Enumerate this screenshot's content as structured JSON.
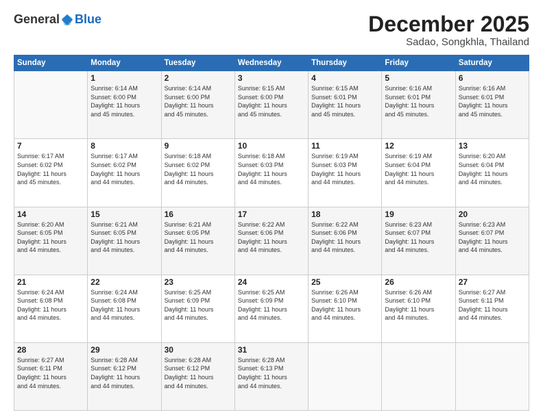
{
  "header": {
    "logo_general": "General",
    "logo_blue": "Blue",
    "title": "December 2025",
    "location": "Sadao, Songkhla, Thailand"
  },
  "days_of_week": [
    "Sunday",
    "Monday",
    "Tuesday",
    "Wednesday",
    "Thursday",
    "Friday",
    "Saturday"
  ],
  "weeks": [
    [
      {
        "day": "",
        "info": ""
      },
      {
        "day": "1",
        "info": "Sunrise: 6:14 AM\nSunset: 6:00 PM\nDaylight: 11 hours\nand 45 minutes."
      },
      {
        "day": "2",
        "info": "Sunrise: 6:14 AM\nSunset: 6:00 PM\nDaylight: 11 hours\nand 45 minutes."
      },
      {
        "day": "3",
        "info": "Sunrise: 6:15 AM\nSunset: 6:00 PM\nDaylight: 11 hours\nand 45 minutes."
      },
      {
        "day": "4",
        "info": "Sunrise: 6:15 AM\nSunset: 6:01 PM\nDaylight: 11 hours\nand 45 minutes."
      },
      {
        "day": "5",
        "info": "Sunrise: 6:16 AM\nSunset: 6:01 PM\nDaylight: 11 hours\nand 45 minutes."
      },
      {
        "day": "6",
        "info": "Sunrise: 6:16 AM\nSunset: 6:01 PM\nDaylight: 11 hours\nand 45 minutes."
      }
    ],
    [
      {
        "day": "7",
        "info": "Sunrise: 6:17 AM\nSunset: 6:02 PM\nDaylight: 11 hours\nand 45 minutes."
      },
      {
        "day": "8",
        "info": "Sunrise: 6:17 AM\nSunset: 6:02 PM\nDaylight: 11 hours\nand 44 minutes."
      },
      {
        "day": "9",
        "info": "Sunrise: 6:18 AM\nSunset: 6:02 PM\nDaylight: 11 hours\nand 44 minutes."
      },
      {
        "day": "10",
        "info": "Sunrise: 6:18 AM\nSunset: 6:03 PM\nDaylight: 11 hours\nand 44 minutes."
      },
      {
        "day": "11",
        "info": "Sunrise: 6:19 AM\nSunset: 6:03 PM\nDaylight: 11 hours\nand 44 minutes."
      },
      {
        "day": "12",
        "info": "Sunrise: 6:19 AM\nSunset: 6:04 PM\nDaylight: 11 hours\nand 44 minutes."
      },
      {
        "day": "13",
        "info": "Sunrise: 6:20 AM\nSunset: 6:04 PM\nDaylight: 11 hours\nand 44 minutes."
      }
    ],
    [
      {
        "day": "14",
        "info": "Sunrise: 6:20 AM\nSunset: 6:05 PM\nDaylight: 11 hours\nand 44 minutes."
      },
      {
        "day": "15",
        "info": "Sunrise: 6:21 AM\nSunset: 6:05 PM\nDaylight: 11 hours\nand 44 minutes."
      },
      {
        "day": "16",
        "info": "Sunrise: 6:21 AM\nSunset: 6:05 PM\nDaylight: 11 hours\nand 44 minutes."
      },
      {
        "day": "17",
        "info": "Sunrise: 6:22 AM\nSunset: 6:06 PM\nDaylight: 11 hours\nand 44 minutes."
      },
      {
        "day": "18",
        "info": "Sunrise: 6:22 AM\nSunset: 6:06 PM\nDaylight: 11 hours\nand 44 minutes."
      },
      {
        "day": "19",
        "info": "Sunrise: 6:23 AM\nSunset: 6:07 PM\nDaylight: 11 hours\nand 44 minutes."
      },
      {
        "day": "20",
        "info": "Sunrise: 6:23 AM\nSunset: 6:07 PM\nDaylight: 11 hours\nand 44 minutes."
      }
    ],
    [
      {
        "day": "21",
        "info": "Sunrise: 6:24 AM\nSunset: 6:08 PM\nDaylight: 11 hours\nand 44 minutes."
      },
      {
        "day": "22",
        "info": "Sunrise: 6:24 AM\nSunset: 6:08 PM\nDaylight: 11 hours\nand 44 minutes."
      },
      {
        "day": "23",
        "info": "Sunrise: 6:25 AM\nSunset: 6:09 PM\nDaylight: 11 hours\nand 44 minutes."
      },
      {
        "day": "24",
        "info": "Sunrise: 6:25 AM\nSunset: 6:09 PM\nDaylight: 11 hours\nand 44 minutes."
      },
      {
        "day": "25",
        "info": "Sunrise: 6:26 AM\nSunset: 6:10 PM\nDaylight: 11 hours\nand 44 minutes."
      },
      {
        "day": "26",
        "info": "Sunrise: 6:26 AM\nSunset: 6:10 PM\nDaylight: 11 hours\nand 44 minutes."
      },
      {
        "day": "27",
        "info": "Sunrise: 6:27 AM\nSunset: 6:11 PM\nDaylight: 11 hours\nand 44 minutes."
      }
    ],
    [
      {
        "day": "28",
        "info": "Sunrise: 6:27 AM\nSunset: 6:11 PM\nDaylight: 11 hours\nand 44 minutes."
      },
      {
        "day": "29",
        "info": "Sunrise: 6:28 AM\nSunset: 6:12 PM\nDaylight: 11 hours\nand 44 minutes."
      },
      {
        "day": "30",
        "info": "Sunrise: 6:28 AM\nSunset: 6:12 PM\nDaylight: 11 hours\nand 44 minutes."
      },
      {
        "day": "31",
        "info": "Sunrise: 6:28 AM\nSunset: 6:13 PM\nDaylight: 11 hours\nand 44 minutes."
      },
      {
        "day": "",
        "info": ""
      },
      {
        "day": "",
        "info": ""
      },
      {
        "day": "",
        "info": ""
      }
    ]
  ]
}
